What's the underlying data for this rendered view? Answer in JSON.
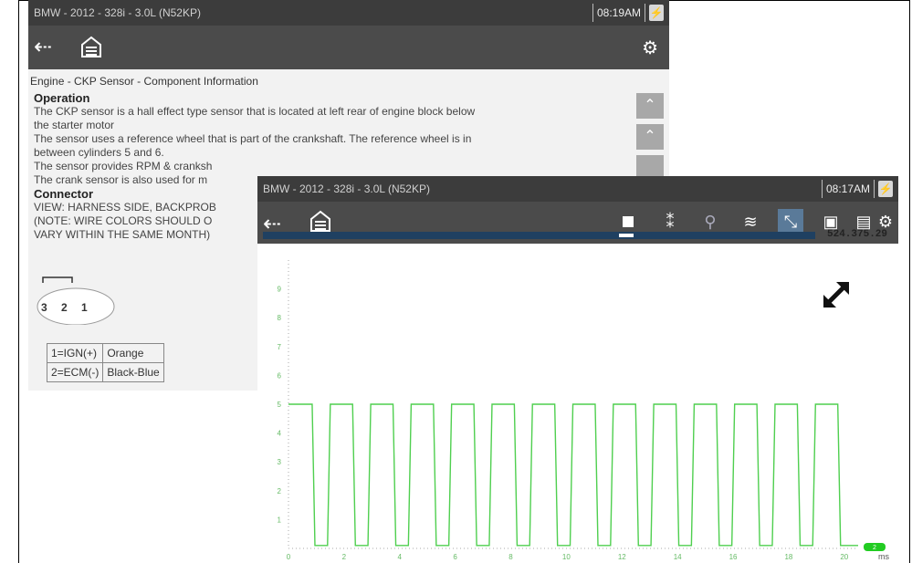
{
  "back_window": {
    "title": "BMW - 2012 - 328i - 3.0L (N52KP)",
    "time": "08:19AM",
    "battery_icon": "battery-icon",
    "breadcrumb": "Engine - CKP Sensor - Component Information",
    "operation_heading": "Operation",
    "operation_lines": [
      "The CKP sensor is a hall effect type sensor that is located at left rear of engine block below",
      "the starter motor",
      "The sensor uses a reference wheel that is part of the crankshaft. The reference wheel is in",
      "between cylinders 5 and 6.",
      "The sensor provides RPM & cranksh",
      "The crank sensor is also used for m"
    ],
    "connector_heading": "Connector",
    "connector_lines": [
      "VIEW: HARNESS SIDE, BACKPROB",
      "(NOTE: WIRE COLORS SHOULD O",
      "VARY WITHIN THE SAME MONTH)"
    ],
    "pin_labels": "3 2 1",
    "pin_table": [
      [
        "1=IGN(+)",
        "Orange"
      ],
      [
        "2=ECM(-)",
        "Black-Blue"
      ]
    ]
  },
  "front_window": {
    "title": "BMW - 2012 - 328i - 3.0L (N52KP)",
    "time": "08:17AM",
    "readout": "524.375.29",
    "unit_label": "ms",
    "channel_badge": "2",
    "toolbar_icons": [
      "stop-icon",
      "cursor-icon",
      "zoom-icon",
      "filter-icon",
      "collapse-icon",
      "save-icon",
      "display-icon",
      "settings-icon"
    ]
  },
  "chart_data": {
    "type": "line",
    "x_ticks": [
      "0",
      "2",
      "4",
      "6",
      "8",
      "10",
      "12",
      "14",
      "16",
      "18",
      "20"
    ],
    "y_ticks": [
      "1",
      "2",
      "3",
      "4",
      "5",
      "6",
      "7",
      "8",
      "9"
    ],
    "xlim": [
      0,
      20.5
    ],
    "ylim": [
      0,
      10
    ],
    "pulse_period": 1.455,
    "pulse_high": 5,
    "pulse_low": 0,
    "pulse_count": 14,
    "pulse_duty": 0.62,
    "color": "#4fcf4f",
    "grid": false
  }
}
